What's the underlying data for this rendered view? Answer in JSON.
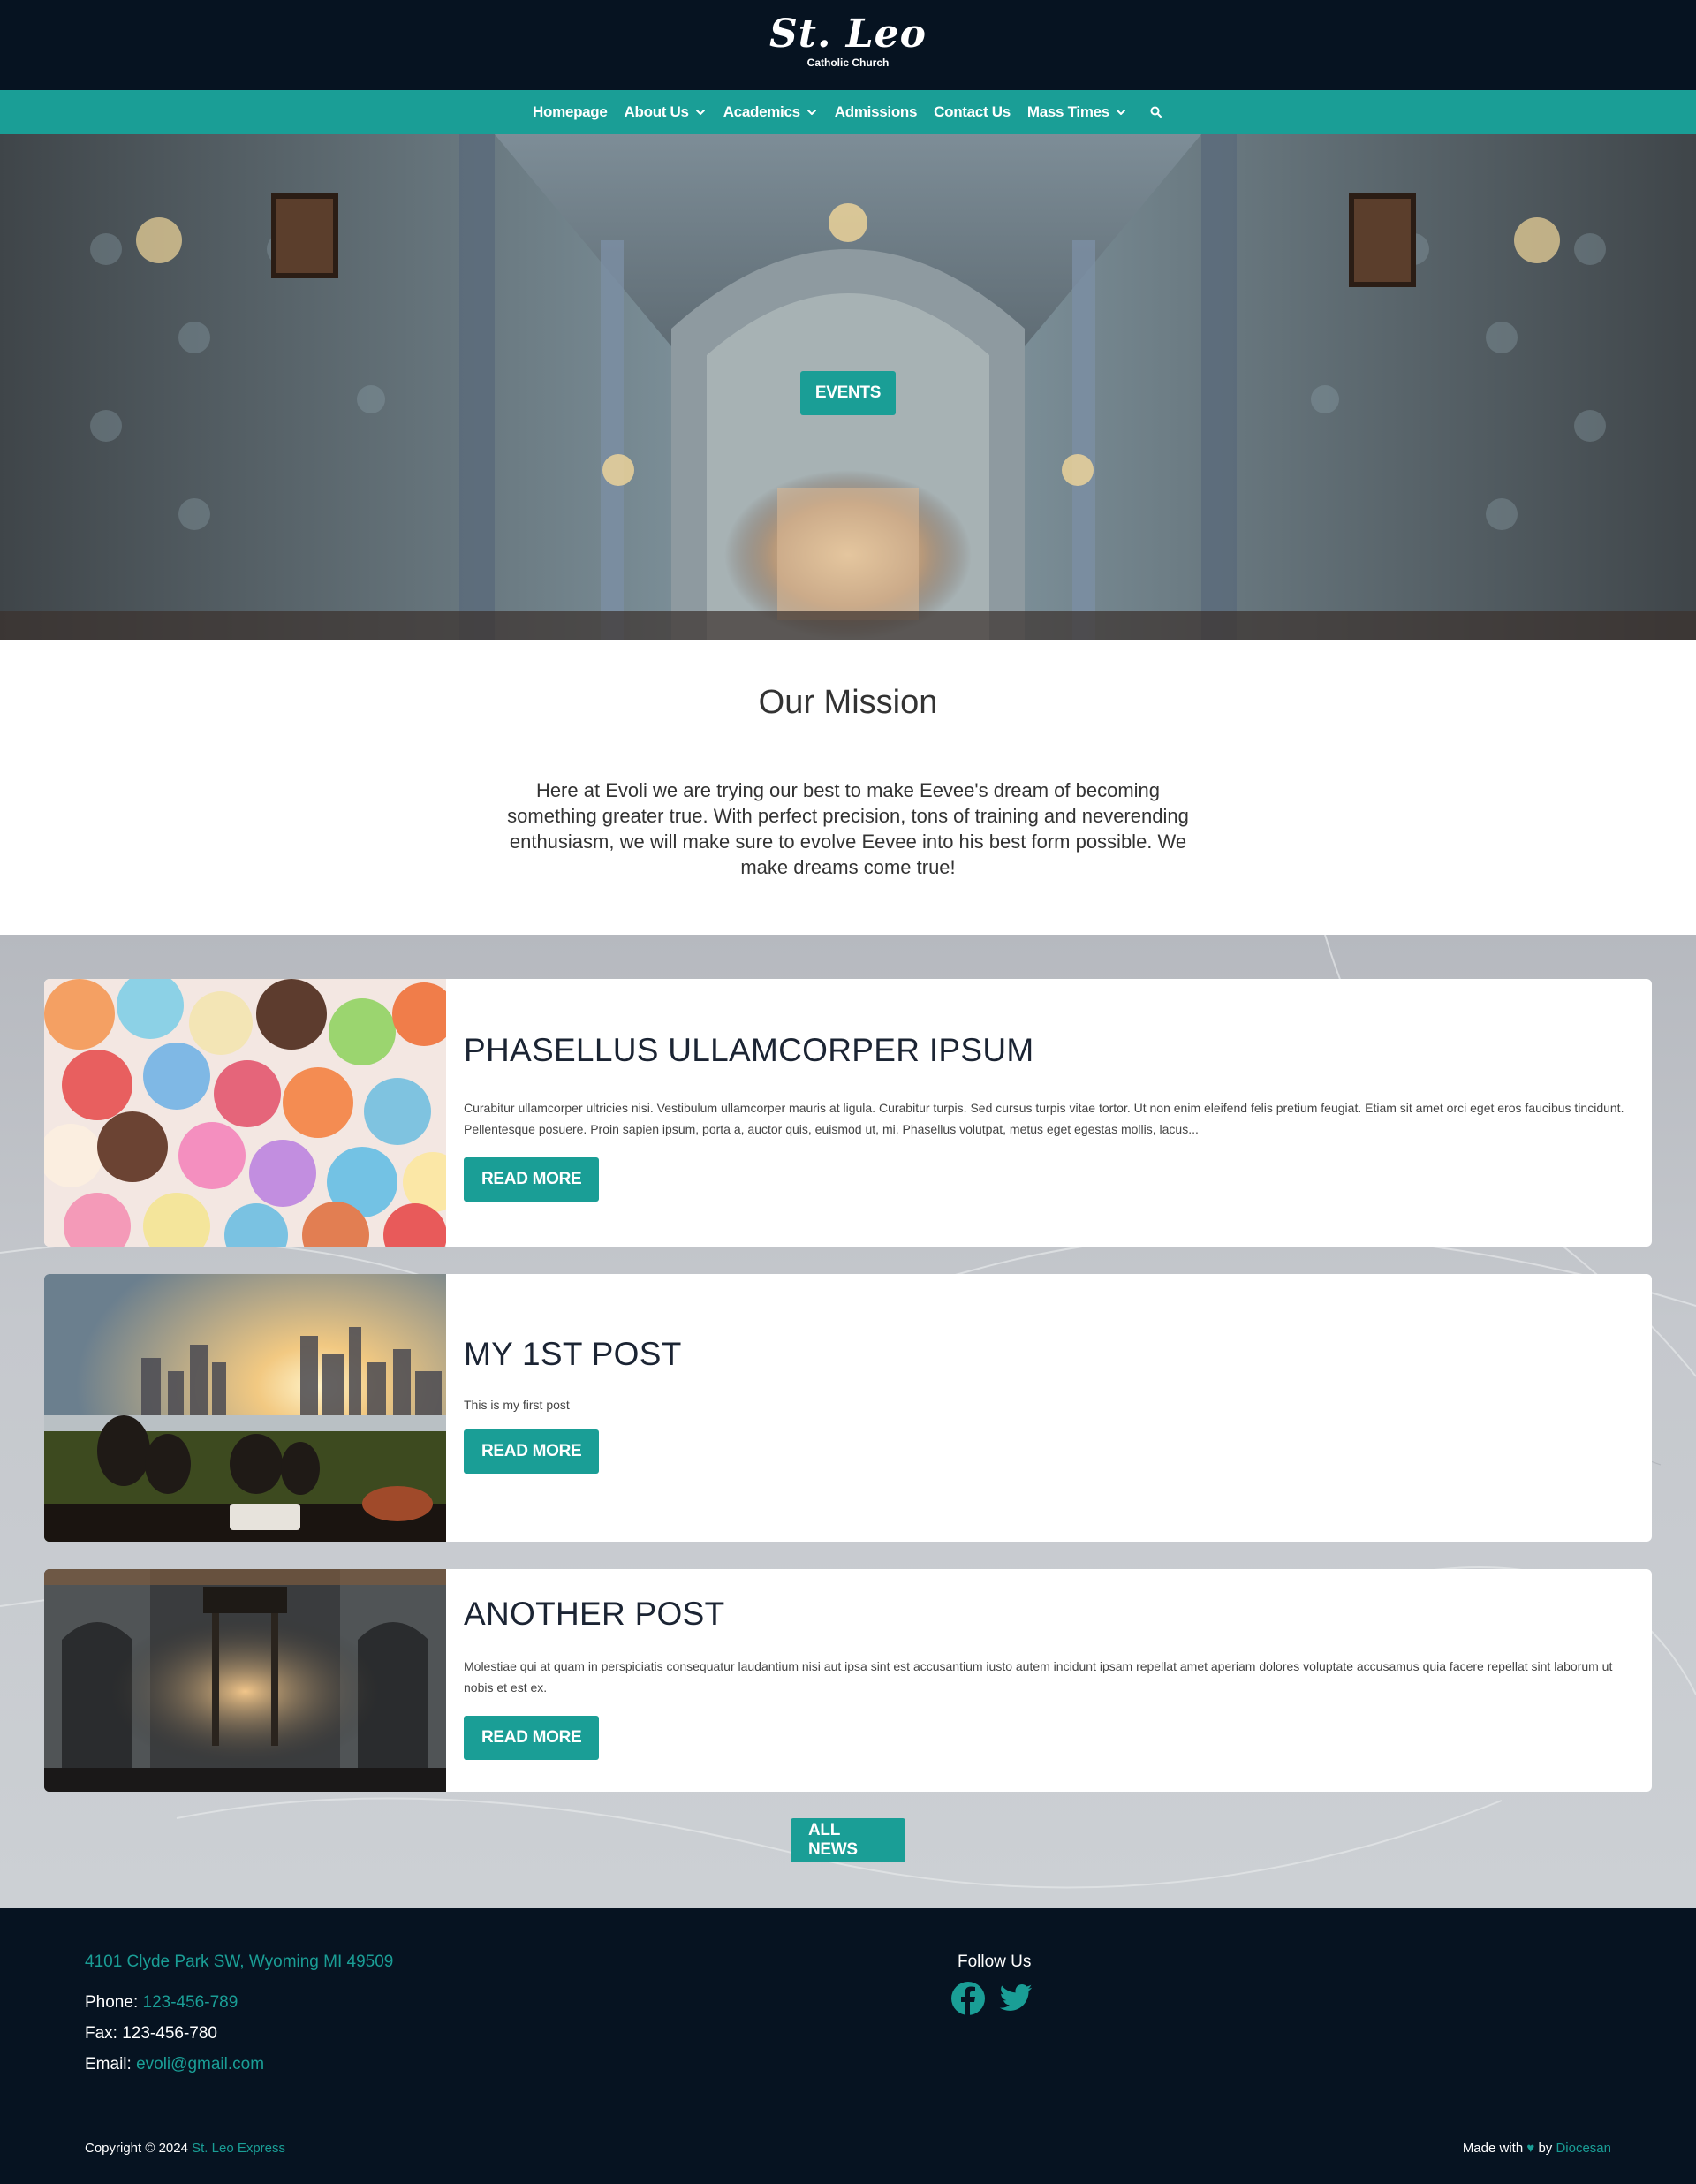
{
  "header": {
    "logo_name": "St. Leo",
    "logo_sub": "Catholic Church"
  },
  "nav": {
    "items": [
      {
        "label": "Homepage",
        "dropdown": false
      },
      {
        "label": "About Us",
        "dropdown": true
      },
      {
        "label": "Academics",
        "dropdown": true
      },
      {
        "label": "Admissions",
        "dropdown": false
      },
      {
        "label": "Contact Us",
        "dropdown": false
      },
      {
        "label": "Mass Times",
        "dropdown": true
      }
    ],
    "search_icon": "search-icon"
  },
  "hero": {
    "button_label": "EVENTS"
  },
  "mission": {
    "title": "Our Mission",
    "text": "Here at Evoli we are trying our best to make Eevee's dream of becoming something greater true. With perfect precision, tons of training and neverending enthusiasm, we will make sure to evolve Eevee into his best form possible. We make dreams come true!"
  },
  "posts": [
    {
      "title": "PHASELLUS ULLAMCORPER IPSUM",
      "excerpt": "Curabitur ullamcorper ultricies nisi. Vestibulum ullamcorper mauris at ligula. Curabitur turpis. Sed cursus turpis vitae tortor. Ut non enim eleifend felis pretium feugiat. Etiam sit amet orci eget eros faucibus tincidunt. Pellentesque posuere. Proin sapien ipsum, porta a, auctor quis, euismod ut, mi. Phasellus volutpat, metus eget egestas mollis, lacus...",
      "button": "READ MORE",
      "image": "macarons"
    },
    {
      "title": "MY 1ST POST",
      "excerpt": "This is my first post",
      "button": "READ MORE",
      "image": "city-sunset-picnic"
    },
    {
      "title": "ANOTHER POST",
      "excerpt": "Molestiae qui at quam in perspiciatis consequatur laudantium nisi aut ipsa sint est accusantium iusto autem incidunt ipsam repellat amet aperiam dolores voluptate accusamus quia facere repellat sint laborum ut nobis et est ex.",
      "button": "READ MORE",
      "image": "basilica-interior"
    }
  ],
  "all_news_label": "ALL NEWS",
  "footer": {
    "address": "4101 Clyde Park SW, Wyoming MI 49509",
    "phone_label": "Phone:",
    "phone": "123-456-789",
    "fax": "Fax: 123-456-780",
    "email_label": "Email:",
    "email": "evoli@gmail.com",
    "follow": "Follow Us",
    "social": [
      "facebook-icon",
      "twitter-icon"
    ],
    "copyright": "Copyright © 2024",
    "copyright_link": "St. Leo Express",
    "made_with": "Made with",
    "made_by": "by",
    "made_link": "Diocesan"
  },
  "colors": {
    "accent": "#1a9e96",
    "dark": "#061321",
    "text": "#333333"
  }
}
